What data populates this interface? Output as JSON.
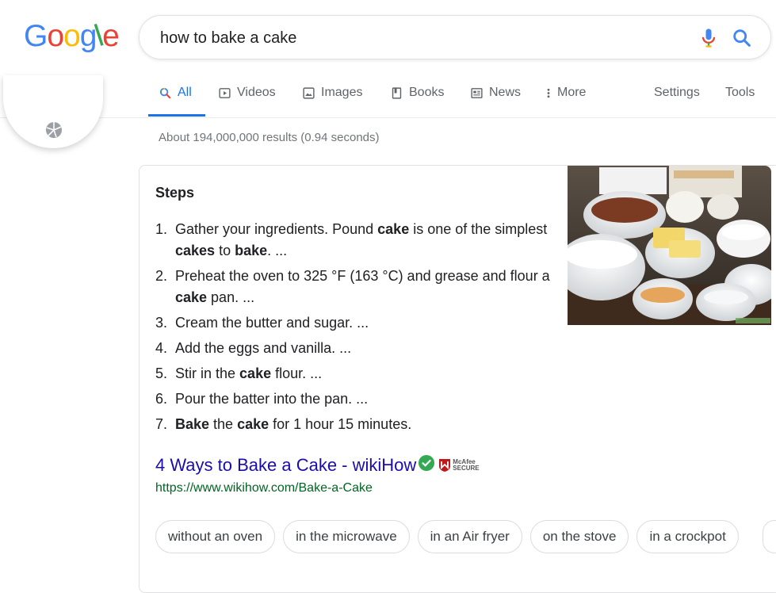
{
  "logo": {
    "letters": [
      "G",
      "o",
      "o",
      "g",
      "l",
      "e"
    ],
    "colors": [
      "#4285F4",
      "#EA4335",
      "#FBBC05",
      "#4285F4",
      "#34A853",
      "#EA4335"
    ]
  },
  "search": {
    "query": "how to bake a cake",
    "mic_icon": "mic-icon",
    "search_icon": "search-icon"
  },
  "tabs": {
    "all": "All",
    "videos": "Videos",
    "images": "Images",
    "books": "Books",
    "news": "News",
    "more": "More",
    "settings": "Settings",
    "tools": "Tools",
    "active_color": "#1a73e8"
  },
  "stats": "About 194,000,000 results (0.94 seconds)",
  "snippet": {
    "title": "Steps",
    "steps": [
      {
        "num": "1.",
        "parts": [
          {
            "t": "Gather your ingredients. Pound ",
            "b": false
          },
          {
            "t": "cake",
            "b": true
          },
          {
            "t": " is one of the simplest ",
            "b": false
          },
          {
            "t": "cakes",
            "b": true
          },
          {
            "t": " to ",
            "b": false
          },
          {
            "t": "bake",
            "b": true
          },
          {
            "t": ". ...",
            "b": false
          }
        ]
      },
      {
        "num": "2.",
        "parts": [
          {
            "t": "Preheat the oven to 325 °F (163 °C) and grease and flour a ",
            "b": false
          },
          {
            "t": "cake",
            "b": true
          },
          {
            "t": " pan. ...",
            "b": false
          }
        ]
      },
      {
        "num": "3.",
        "parts": [
          {
            "t": "Cream the butter and sugar. ...",
            "b": false
          }
        ]
      },
      {
        "num": "4.",
        "parts": [
          {
            "t": "Add the eggs and vanilla. ...",
            "b": false
          }
        ]
      },
      {
        "num": "5.",
        "parts": [
          {
            "t": "Stir in the ",
            "b": false
          },
          {
            "t": "cake",
            "b": true
          },
          {
            "t": " flour. ...",
            "b": false
          }
        ]
      },
      {
        "num": "6.",
        "parts": [
          {
            "t": "Pour the batter into the pan. ...",
            "b": false
          }
        ]
      },
      {
        "num": "7.",
        "parts": [
          {
            "t": "Bake",
            "b": true
          },
          {
            "t": " the ",
            "b": false
          },
          {
            "t": "cake",
            "b": true
          },
          {
            "t": " for 1 hour 15 minutes.",
            "b": false
          }
        ]
      }
    ],
    "image_alt": "baking ingredients in bowls",
    "result_title": "4 Ways to Bake a Cake - wikiHow",
    "result_url": "https://www.wikihow.com/Bake-a-Cake",
    "badge_top": "McAfee",
    "badge_bottom": "SECURE",
    "verified_color": "#34A853",
    "mcafee_color": "#C01818"
  },
  "chips": [
    "without an oven",
    "in the microwave",
    "in an Air fryer",
    "on the stove",
    "in a crockpot"
  ]
}
